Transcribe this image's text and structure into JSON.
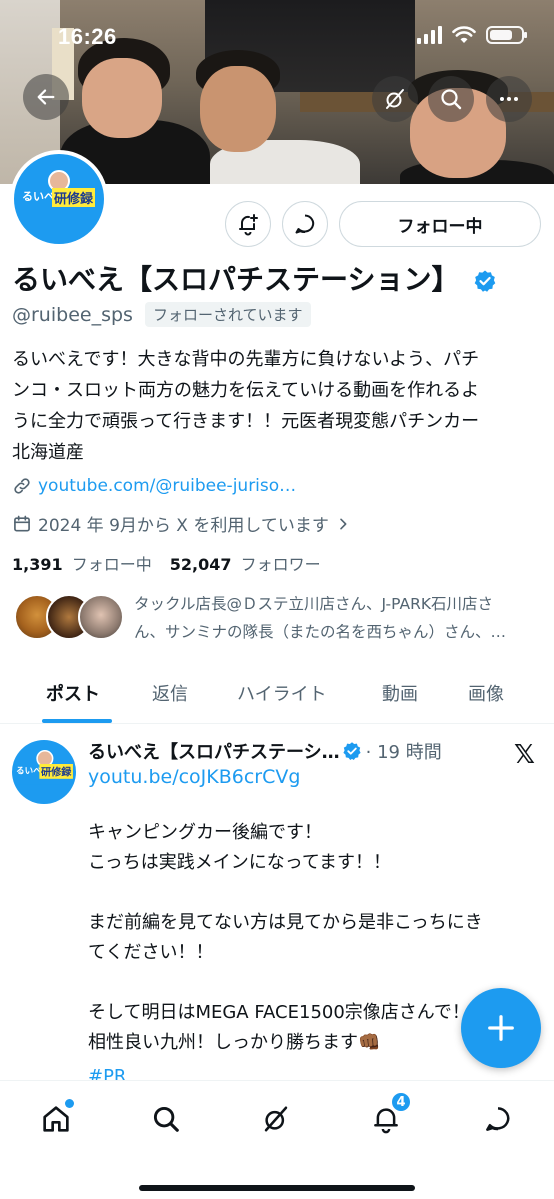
{
  "status_bar": {
    "time": "16:26"
  },
  "profile": {
    "display_name": "るいべえ【スロパチステーション】",
    "handle": "@ruibee_sps",
    "follows_you": "フォローされています",
    "follow_button": "フォロー中",
    "bio_lines": [
      "るいべえです！大きな背中の先輩方に負けないよう、パチ",
      "ンコ・スロット両方の魅力を伝えていける動画を作れるよ",
      "うに全力で頑張って行きます！！元医者現変態パチンカー",
      "北海道産"
    ],
    "link": "youtube.com/@ruibee-juriso…",
    "joined": "2024 年 9月から X を利用しています",
    "following_count": "1,391",
    "following_label": "フォロー中",
    "followers_count": "52,047",
    "followers_label": "フォロワー",
    "followed_by_lines": [
      "タックル店長@Ｄステ立川店さん、J-PARK石川店さ",
      "ん、サンミナの隊長（またの名を西ちゃん）さん、…"
    ]
  },
  "tabs": [
    "ポスト",
    "返信",
    "ハイライト",
    "動画",
    "画像"
  ],
  "tweet": {
    "name": "るいべえ【スロパチステーシ…",
    "time": "· 19 時間",
    "link": "youtu.be/coJKB6crCVg",
    "lines": [
      "キャンピングカー後編です！",
      "こっちは実践メインになってます！！",
      "",
      "まだ前編を見てない方は見てから是非こっちにき",
      "てください！！",
      "",
      "そして明日はMEGA FACE1500宗像店さんで！",
      "相性良い九州！しっかり勝ちます👊🏾"
    ],
    "hashtag": "#PR"
  },
  "nav": {
    "notifications_badge": "4"
  },
  "colors": {
    "accent": "#1d9bf0",
    "text": "#0f1419",
    "secondary": "#536471"
  }
}
